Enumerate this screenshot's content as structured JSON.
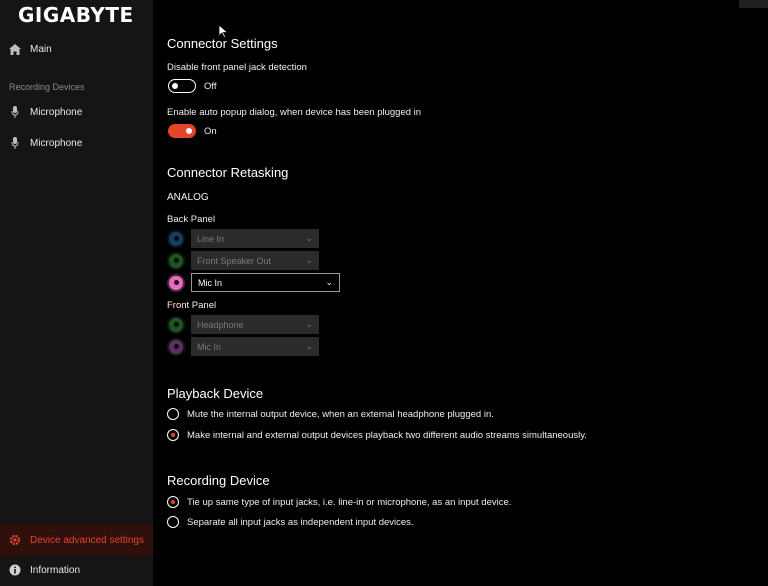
{
  "app": {
    "logo_text": "GIGABYTE"
  },
  "sidebar": {
    "main_label": "Main",
    "recording_heading": "Recording Devices",
    "microphone_1": "Microphone",
    "microphone_2": "Microphone",
    "advanced_label": "Device advanced settings",
    "info_label": "Information"
  },
  "connector_settings": {
    "title": "Connector Settings",
    "jack_detection_label": "Disable front panel jack detection",
    "jack_detection_state": "Off",
    "popup_label": "Enable auto popup dialog, when device has been plugged in",
    "popup_state": "On"
  },
  "retasking": {
    "title": "Connector Retasking",
    "analog_label": "ANALOG",
    "back_panel_label": "Back Panel",
    "back_jacks": [
      {
        "value": "Line In",
        "color": "#2f6fb0",
        "enabled": false
      },
      {
        "value": "Front Speaker Out",
        "color": "#3a9a3a",
        "enabled": false
      },
      {
        "value": "Mic In",
        "color": "#e86bbf",
        "enabled": true
      }
    ],
    "front_panel_label": "Front Panel",
    "front_jacks": [
      {
        "value": "Headphone",
        "color": "#3a9a3a",
        "enabled": false
      },
      {
        "value": "Mic In",
        "color": "#a05ab0",
        "enabled": false
      }
    ]
  },
  "playback": {
    "title": "Playback Device",
    "option_mute": "Mute the internal output device, when an external headphone plugged in.",
    "option_two_streams": "Make internal and external output devices playback two different audio streams simultaneously.",
    "selected": "option_two_streams"
  },
  "recording": {
    "title": "Recording Device",
    "option_tie": "Tie up same type of input jacks, i.e. line-in or microphone, as an input device.",
    "option_separate": "Separate all input jacks as independent input devices.",
    "selected": "option_tie"
  },
  "colors": {
    "accent": "#e4452a",
    "sidebar_bg": "#151515",
    "background": "#000000"
  }
}
